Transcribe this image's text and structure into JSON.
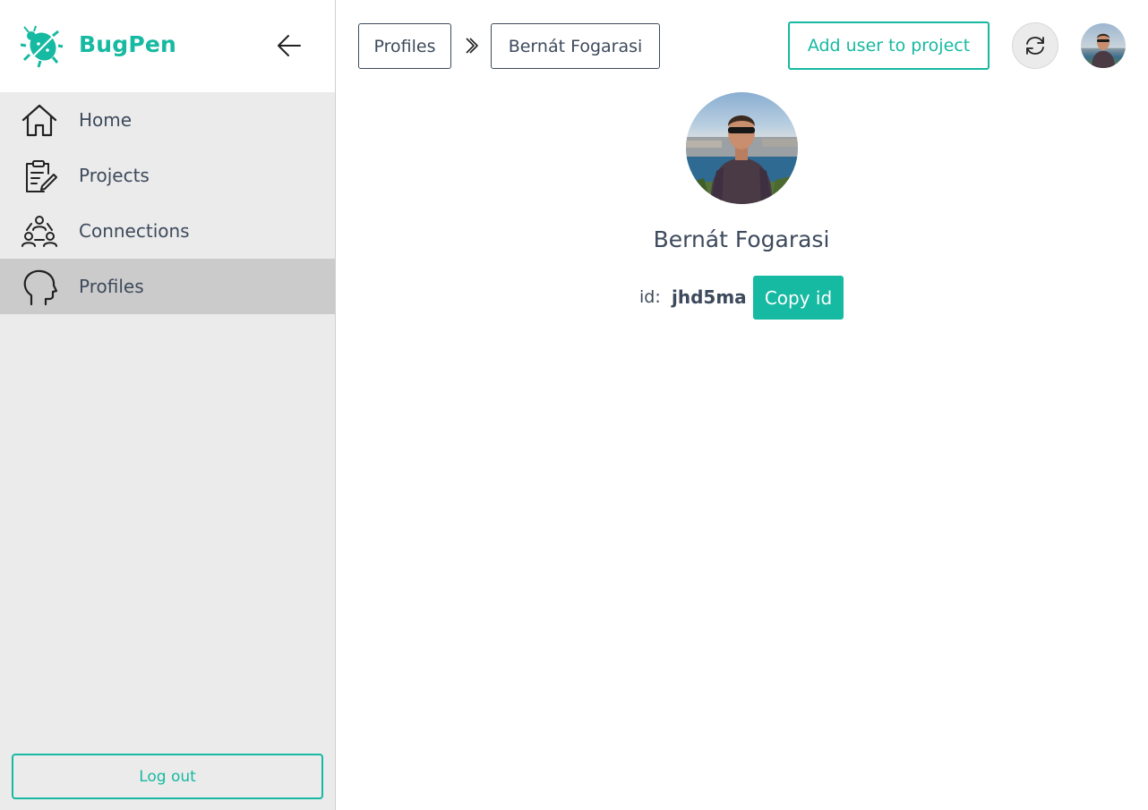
{
  "brand": {
    "name": "BugPen",
    "logo_icon": "bug-icon",
    "accent_color": "#16b9a1"
  },
  "sidebar": {
    "collapse_icon": "arrow-left-icon",
    "items": [
      {
        "label": "Home",
        "icon": "home-icon",
        "active": false
      },
      {
        "label": "Projects",
        "icon": "clipboard-edit-icon",
        "active": false
      },
      {
        "label": "Connections",
        "icon": "people-network-icon",
        "active": false
      },
      {
        "label": "Profiles",
        "icon": "head-profile-icon",
        "active": true
      }
    ],
    "logout_label": "Log out"
  },
  "breadcrumb": {
    "items": [
      "Profiles",
      "Bernát Fogarasi"
    ],
    "separator_icon": "chevron-right-icon"
  },
  "header": {
    "add_user_label": "Add user to project",
    "refresh_icon": "refresh-icon",
    "avatar_icon": "user-avatar-photo"
  },
  "profile": {
    "name": "Bernát Fogarasi",
    "id_label": "id:",
    "id_value": "jhd5ma",
    "copy_label": "Copy id"
  }
}
